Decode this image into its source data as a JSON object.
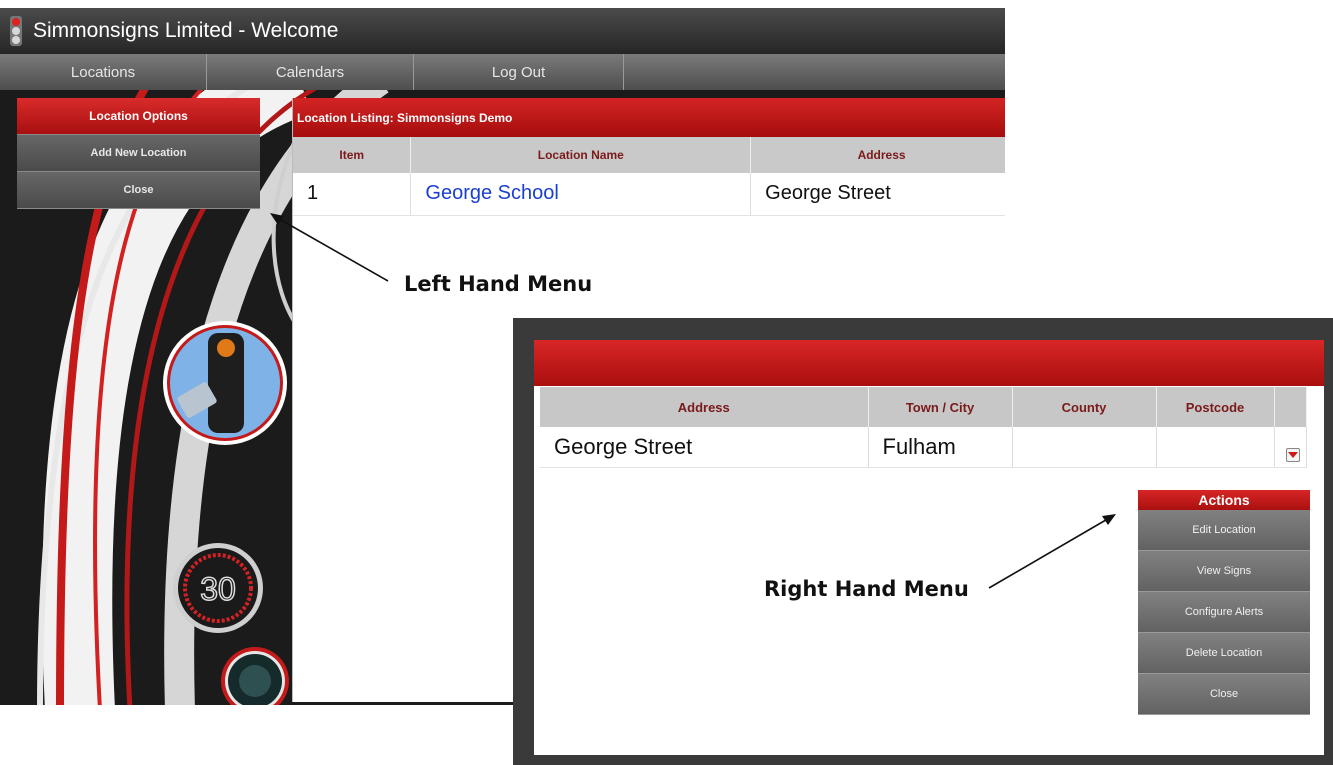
{
  "window": {
    "title": "Simmonsigns Limited - Welcome"
  },
  "nav": {
    "items": [
      "Locations",
      "Calendars",
      "Log Out"
    ]
  },
  "left_menu": {
    "header": "Location Options",
    "items": [
      "Add New Location",
      "Close"
    ]
  },
  "listing": {
    "title": "Location Listing: Simmonsigns Demo",
    "columns": [
      "Item",
      "Location Name",
      "Address"
    ],
    "rows": [
      {
        "item": "1",
        "name": "George School",
        "address": "George Street"
      }
    ]
  },
  "callouts": {
    "left": "Left Hand Menu",
    "right": "Right Hand Menu"
  },
  "inset": {
    "columns": [
      "Address",
      "Town / City",
      "County",
      "Postcode"
    ],
    "row": {
      "address": "George Street",
      "town": "Fulham",
      "county": "",
      "postcode": ""
    }
  },
  "right_menu": {
    "header": "Actions",
    "items": [
      "Edit Location",
      "View Signs",
      "Configure Alerts",
      "Delete Location",
      "Close"
    ]
  },
  "signs": {
    "speed_value": "30"
  },
  "colors": {
    "brand_red": "#c41a1a",
    "dark_bg": "#1b1b1b",
    "link_blue": "#1a3fd0"
  }
}
